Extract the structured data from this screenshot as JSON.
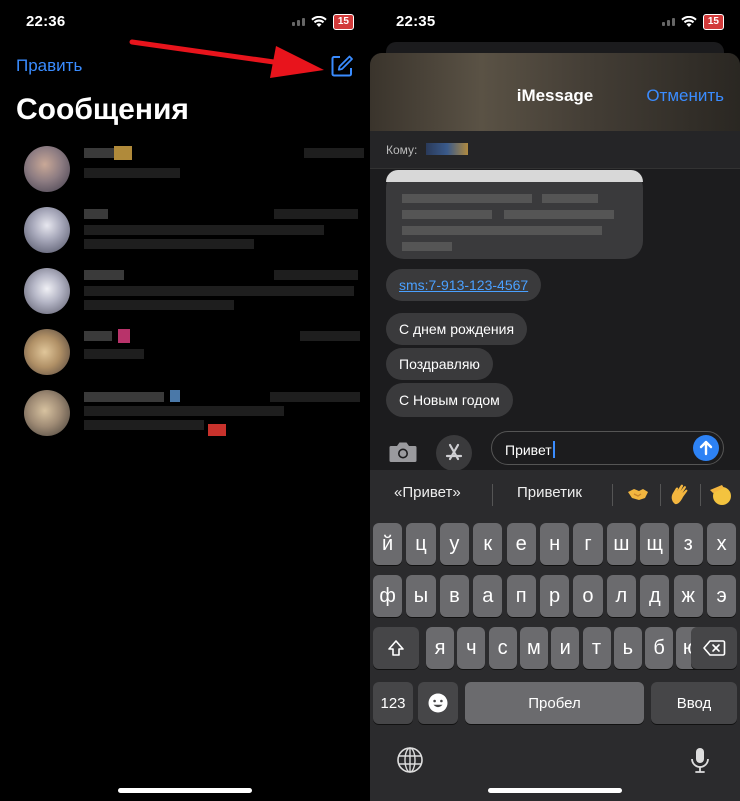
{
  "left": {
    "status": {
      "time": "22:36",
      "battery": "15"
    },
    "edit_label": "Править",
    "title": "Сообщения",
    "conversations_count_visible": 5
  },
  "right": {
    "status": {
      "time": "22:35",
      "battery": "15"
    },
    "sheet_title": "iMessage",
    "cancel_label": "Отменить",
    "to_label": "Кому:",
    "messages": [
      {
        "text": "sms:7-913-123-4567",
        "kind": "link"
      },
      {
        "text": "С днем рождения",
        "kind": "text"
      },
      {
        "text": "Поздравляю",
        "kind": "text"
      },
      {
        "text": "С Новым годом",
        "kind": "text"
      }
    ],
    "input_value": "Привет",
    "suggestions": [
      "«Привет»",
      "Приветик"
    ],
    "keyboard": {
      "row1": [
        "й",
        "ц",
        "у",
        "к",
        "е",
        "н",
        "г",
        "ш",
        "щ",
        "з",
        "х"
      ],
      "row2": [
        "ф",
        "ы",
        "в",
        "а",
        "п",
        "р",
        "о",
        "л",
        "д",
        "ж",
        "э"
      ],
      "row3": [
        "я",
        "ч",
        "с",
        "м",
        "и",
        "т",
        "ь",
        "б",
        "ю"
      ],
      "numbers_label": "123",
      "space_label": "Пробел",
      "return_label": "Ввод"
    }
  },
  "colors": {
    "accent": "#3a8cff",
    "arrow": "#e8141c",
    "send": "#2d82f5"
  }
}
